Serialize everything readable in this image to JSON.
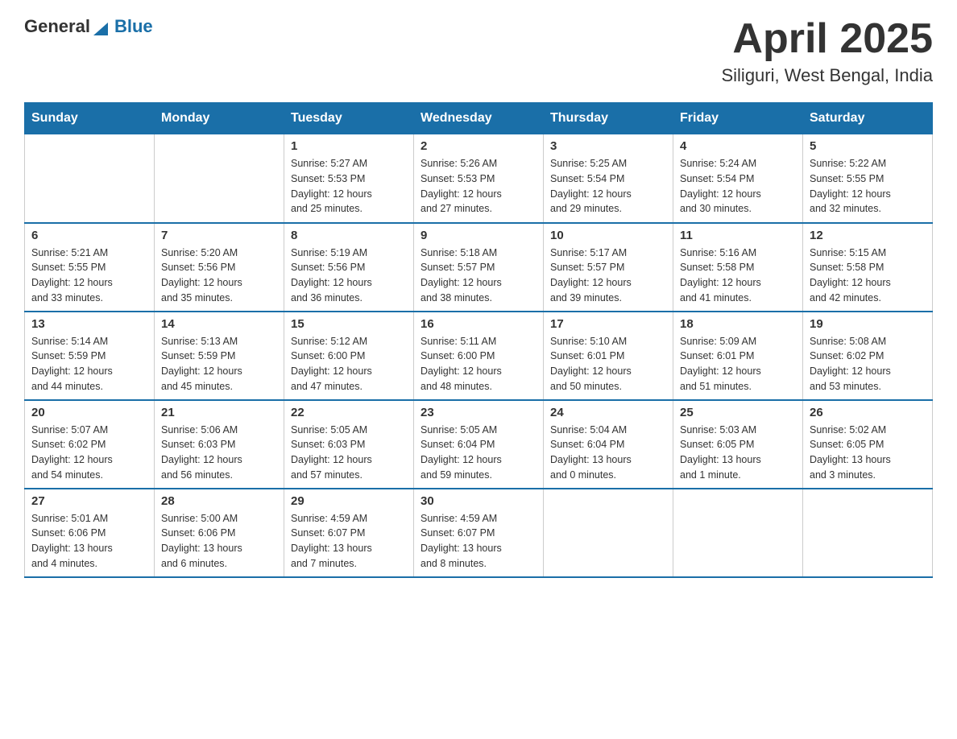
{
  "header": {
    "logo_general": "General",
    "logo_blue": "Blue",
    "month": "April 2025",
    "location": "Siliguri, West Bengal, India"
  },
  "weekdays": [
    "Sunday",
    "Monday",
    "Tuesday",
    "Wednesday",
    "Thursday",
    "Friday",
    "Saturday"
  ],
  "weeks": [
    [
      {
        "day": "",
        "info": ""
      },
      {
        "day": "",
        "info": ""
      },
      {
        "day": "1",
        "info": "Sunrise: 5:27 AM\nSunset: 5:53 PM\nDaylight: 12 hours\nand 25 minutes."
      },
      {
        "day": "2",
        "info": "Sunrise: 5:26 AM\nSunset: 5:53 PM\nDaylight: 12 hours\nand 27 minutes."
      },
      {
        "day": "3",
        "info": "Sunrise: 5:25 AM\nSunset: 5:54 PM\nDaylight: 12 hours\nand 29 minutes."
      },
      {
        "day": "4",
        "info": "Sunrise: 5:24 AM\nSunset: 5:54 PM\nDaylight: 12 hours\nand 30 minutes."
      },
      {
        "day": "5",
        "info": "Sunrise: 5:22 AM\nSunset: 5:55 PM\nDaylight: 12 hours\nand 32 minutes."
      }
    ],
    [
      {
        "day": "6",
        "info": "Sunrise: 5:21 AM\nSunset: 5:55 PM\nDaylight: 12 hours\nand 33 minutes."
      },
      {
        "day": "7",
        "info": "Sunrise: 5:20 AM\nSunset: 5:56 PM\nDaylight: 12 hours\nand 35 minutes."
      },
      {
        "day": "8",
        "info": "Sunrise: 5:19 AM\nSunset: 5:56 PM\nDaylight: 12 hours\nand 36 minutes."
      },
      {
        "day": "9",
        "info": "Sunrise: 5:18 AM\nSunset: 5:57 PM\nDaylight: 12 hours\nand 38 minutes."
      },
      {
        "day": "10",
        "info": "Sunrise: 5:17 AM\nSunset: 5:57 PM\nDaylight: 12 hours\nand 39 minutes."
      },
      {
        "day": "11",
        "info": "Sunrise: 5:16 AM\nSunset: 5:58 PM\nDaylight: 12 hours\nand 41 minutes."
      },
      {
        "day": "12",
        "info": "Sunrise: 5:15 AM\nSunset: 5:58 PM\nDaylight: 12 hours\nand 42 minutes."
      }
    ],
    [
      {
        "day": "13",
        "info": "Sunrise: 5:14 AM\nSunset: 5:59 PM\nDaylight: 12 hours\nand 44 minutes."
      },
      {
        "day": "14",
        "info": "Sunrise: 5:13 AM\nSunset: 5:59 PM\nDaylight: 12 hours\nand 45 minutes."
      },
      {
        "day": "15",
        "info": "Sunrise: 5:12 AM\nSunset: 6:00 PM\nDaylight: 12 hours\nand 47 minutes."
      },
      {
        "day": "16",
        "info": "Sunrise: 5:11 AM\nSunset: 6:00 PM\nDaylight: 12 hours\nand 48 minutes."
      },
      {
        "day": "17",
        "info": "Sunrise: 5:10 AM\nSunset: 6:01 PM\nDaylight: 12 hours\nand 50 minutes."
      },
      {
        "day": "18",
        "info": "Sunrise: 5:09 AM\nSunset: 6:01 PM\nDaylight: 12 hours\nand 51 minutes."
      },
      {
        "day": "19",
        "info": "Sunrise: 5:08 AM\nSunset: 6:02 PM\nDaylight: 12 hours\nand 53 minutes."
      }
    ],
    [
      {
        "day": "20",
        "info": "Sunrise: 5:07 AM\nSunset: 6:02 PM\nDaylight: 12 hours\nand 54 minutes."
      },
      {
        "day": "21",
        "info": "Sunrise: 5:06 AM\nSunset: 6:03 PM\nDaylight: 12 hours\nand 56 minutes."
      },
      {
        "day": "22",
        "info": "Sunrise: 5:05 AM\nSunset: 6:03 PM\nDaylight: 12 hours\nand 57 minutes."
      },
      {
        "day": "23",
        "info": "Sunrise: 5:05 AM\nSunset: 6:04 PM\nDaylight: 12 hours\nand 59 minutes."
      },
      {
        "day": "24",
        "info": "Sunrise: 5:04 AM\nSunset: 6:04 PM\nDaylight: 13 hours\nand 0 minutes."
      },
      {
        "day": "25",
        "info": "Sunrise: 5:03 AM\nSunset: 6:05 PM\nDaylight: 13 hours\nand 1 minute."
      },
      {
        "day": "26",
        "info": "Sunrise: 5:02 AM\nSunset: 6:05 PM\nDaylight: 13 hours\nand 3 minutes."
      }
    ],
    [
      {
        "day": "27",
        "info": "Sunrise: 5:01 AM\nSunset: 6:06 PM\nDaylight: 13 hours\nand 4 minutes."
      },
      {
        "day": "28",
        "info": "Sunrise: 5:00 AM\nSunset: 6:06 PM\nDaylight: 13 hours\nand 6 minutes."
      },
      {
        "day": "29",
        "info": "Sunrise: 4:59 AM\nSunset: 6:07 PM\nDaylight: 13 hours\nand 7 minutes."
      },
      {
        "day": "30",
        "info": "Sunrise: 4:59 AM\nSunset: 6:07 PM\nDaylight: 13 hours\nand 8 minutes."
      },
      {
        "day": "",
        "info": ""
      },
      {
        "day": "",
        "info": ""
      },
      {
        "day": "",
        "info": ""
      }
    ]
  ]
}
